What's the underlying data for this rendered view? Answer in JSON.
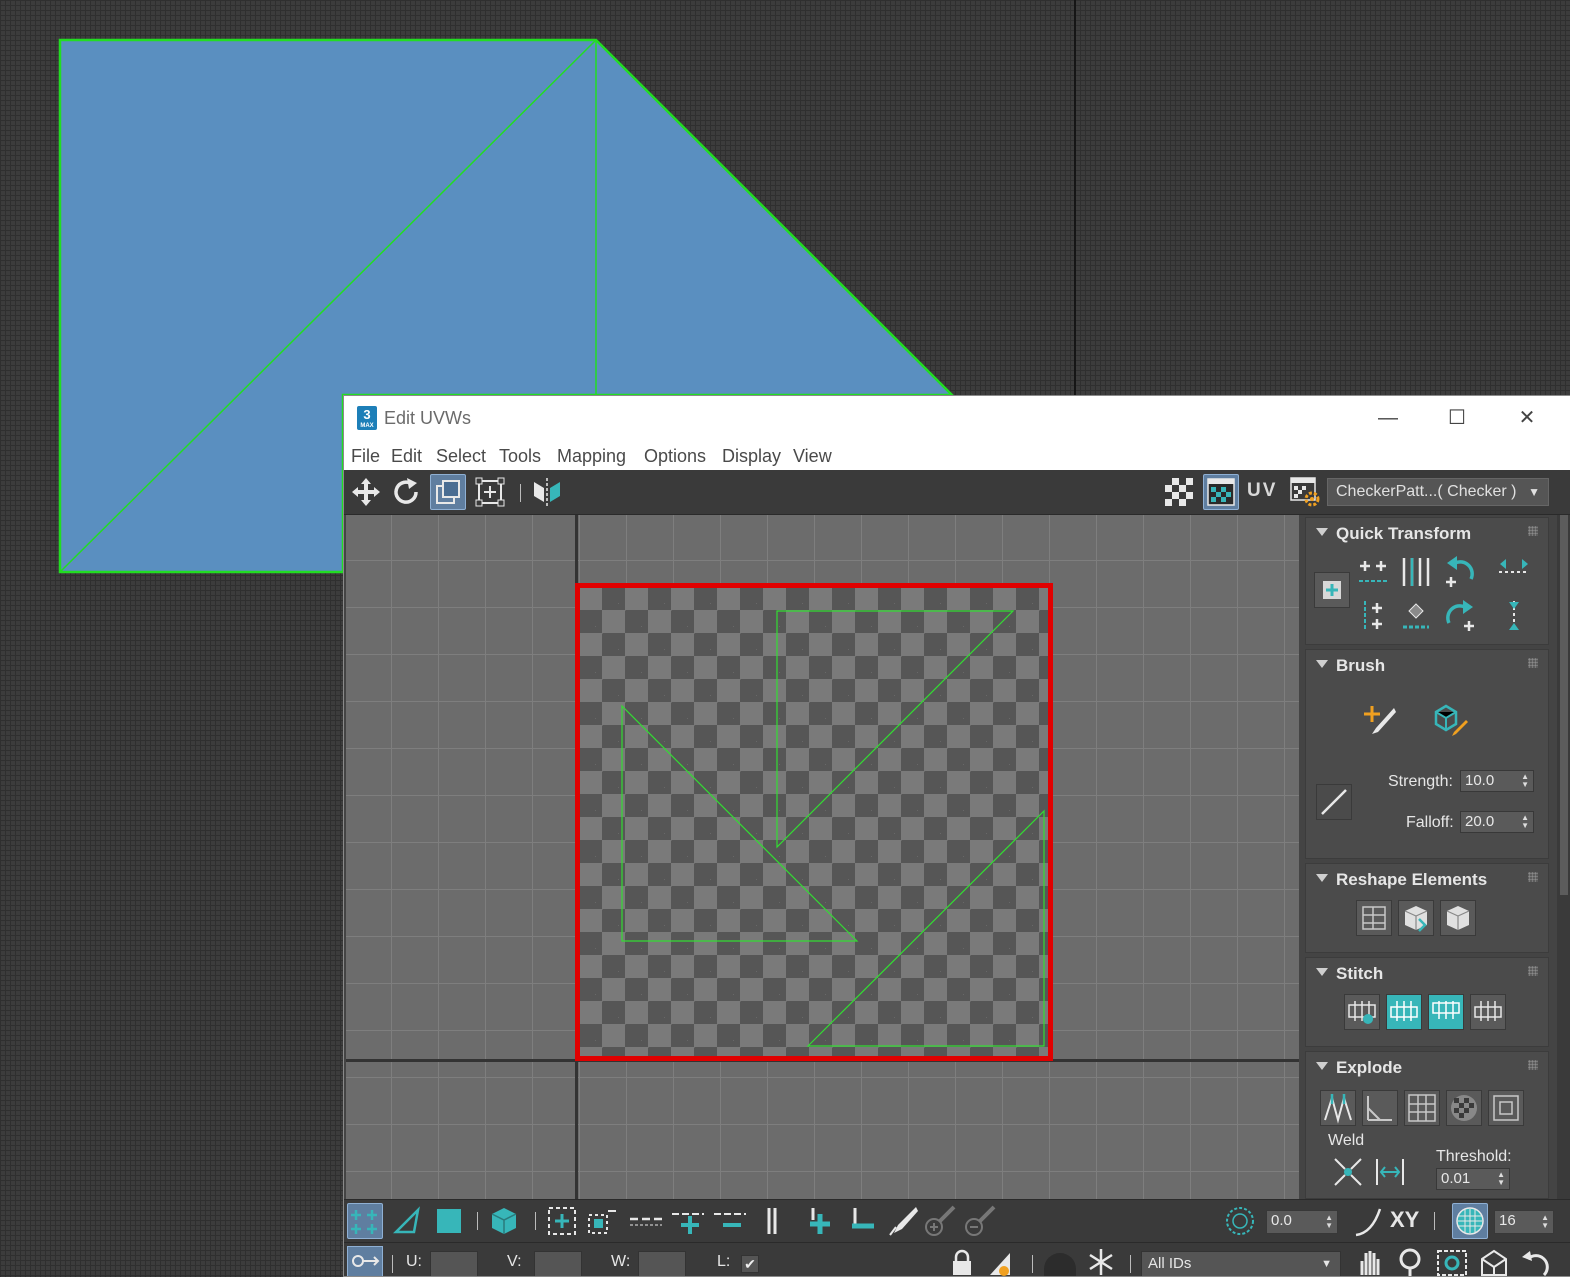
{
  "window": {
    "title": "Edit UVWs",
    "app_icon_label": "3",
    "app_icon_sub": "MAX",
    "controls": {
      "minimize": "—",
      "maximize": "☐",
      "close": "✕"
    }
  },
  "menu": {
    "items": [
      "File",
      "Edit",
      "Select",
      "Tools",
      "Mapping",
      "Options",
      "Display",
      "View"
    ]
  },
  "toolbar": {
    "uv_label": "UV",
    "texture_dropdown": "CheckerPatt...( Checker )",
    "active_tool": "freeform-mode"
  },
  "colors": {
    "highlight": "#e10000",
    "uv_edge": "#33cc33",
    "mesh_fill": "#5a8fc0",
    "accent": "#37b6b9"
  },
  "panel": {
    "quick_transform": {
      "title": "Quick Transform"
    },
    "brush": {
      "title": "Brush",
      "strength_label": "Strength:",
      "strength_value": "10.0",
      "falloff_label": "Falloff:",
      "falloff_value": "20.0"
    },
    "reshape": {
      "title": "Reshape Elements"
    },
    "stitch": {
      "title": "Stitch"
    },
    "explode": {
      "title": "Explode",
      "weld_label": "Weld",
      "threshold_label": "Threshold:",
      "threshold_value": "0.01"
    }
  },
  "bottom": {
    "angle_value": "0.0",
    "xy_label": "XY",
    "divisions_value": "16",
    "u_label": "U:",
    "v_label": "V:",
    "w_label": "W:",
    "l_label": "L:",
    "l_checked": true,
    "id_filter": "All IDs"
  }
}
